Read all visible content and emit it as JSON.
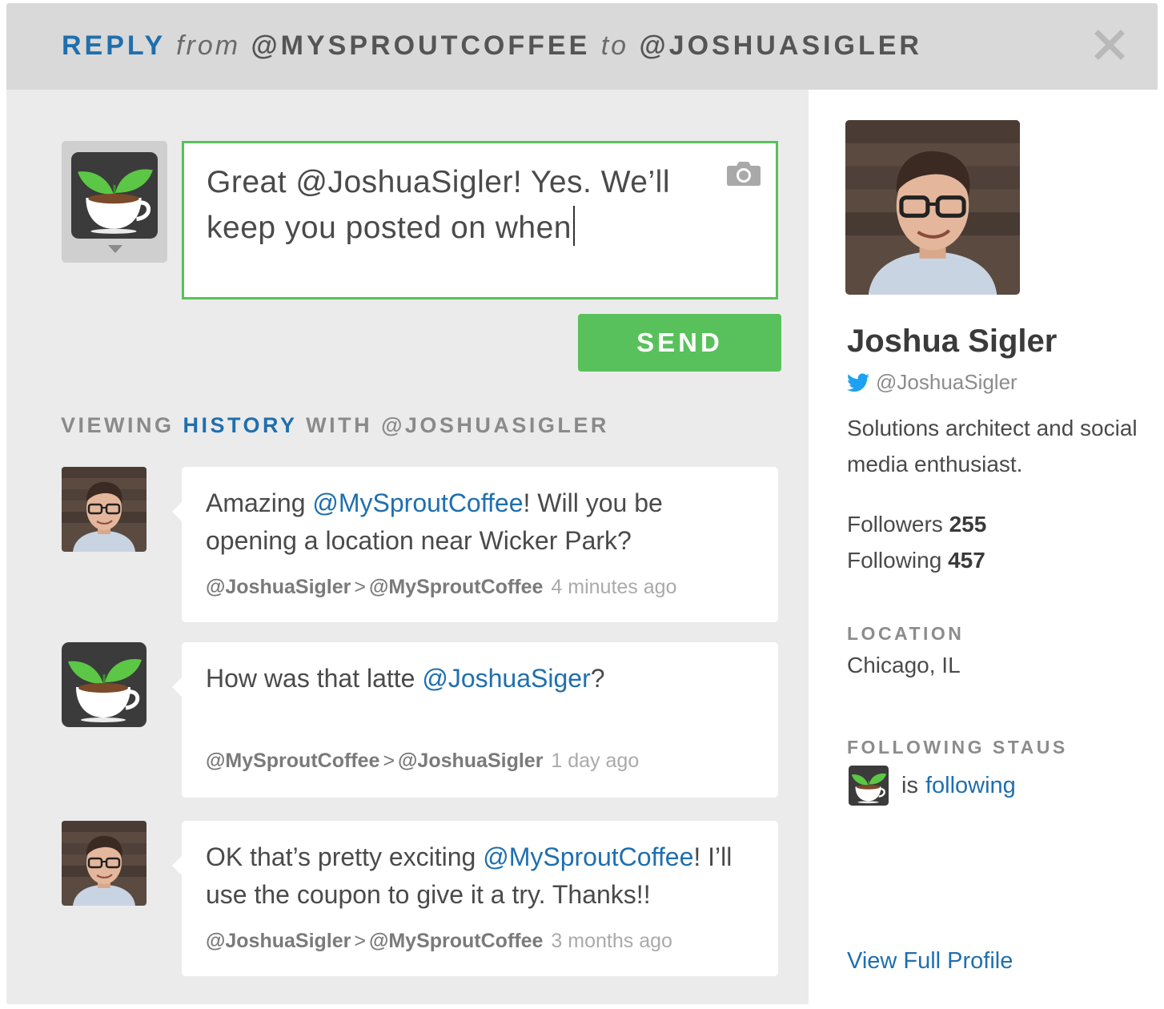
{
  "header": {
    "reply_label": "REPLY",
    "from_label": "from",
    "from_account": "@MYSPROUTCOFFEE",
    "to_label": "to",
    "to_account": "@JOSHUASIGLER"
  },
  "composer": {
    "text": "Great @JoshuaSigler! Yes. We’ll keep you posted on when",
    "send_label": "SEND"
  },
  "history": {
    "label_prefix": "VIEWING",
    "label_highlight": "HISTORY",
    "label_suffix": "WITH @JOSHUASIGLER",
    "messages": [
      {
        "avatar": "person",
        "text_before": "Amazing ",
        "mention": "@MySproutCoffee",
        "text_after": "! Will you be opening a location near Wicker Park?",
        "from": "@JoshuaSigler",
        "arrow": ">",
        "to": "@MySproutCoffee",
        "time": "4 minutes ago"
      },
      {
        "avatar": "coffee",
        "text_before": "How was that latte ",
        "mention": "@JoshuaSiger",
        "text_after": "?",
        "from": "@MySproutCoffee",
        "arrow": ">",
        "to": "@JoshuaSigler",
        "time": "1 day ago"
      },
      {
        "avatar": "person",
        "text_before": "OK that’s pretty exciting ",
        "mention": "@MySproutCoffee",
        "text_after": "! I’ll use the coupon to give it a try. Thanks!!",
        "from": "@JoshuaSigler",
        "arrow": ">",
        "to": "@MySproutCoffee",
        "time": "3 months ago"
      }
    ]
  },
  "profile": {
    "name": "Joshua Sigler",
    "handle": "@JoshuaSigler",
    "bio": "Solutions architect and social media enthusiast.",
    "followers_label": "Followers",
    "followers": "255",
    "following_label": "Following",
    "following": "457",
    "location_label": "LOCATION",
    "location": "Chicago, IL",
    "status_label": "FOLLOWING STAUS",
    "status_is": "is",
    "status_link": "following",
    "view_profile": "View Full Profile"
  },
  "colors": {
    "accent_green": "#59c15b",
    "link_blue": "#1f6fae",
    "twitter_blue": "#1da1f2"
  },
  "icons": [
    "close-icon",
    "camera-icon",
    "twitter-bird-icon",
    "chevron-down-icon"
  ]
}
